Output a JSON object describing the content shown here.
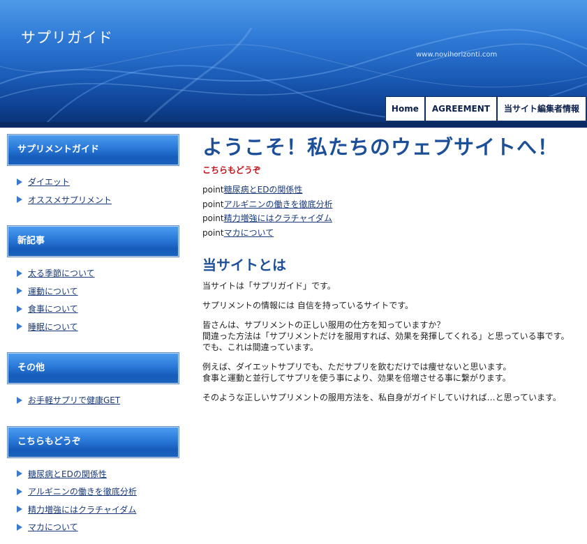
{
  "header": {
    "site_title": "サプリガイド",
    "site_url": "www.novihorizonti.com",
    "nav": [
      "Home",
      "AGREEMENT",
      "当サイト編集者情報"
    ]
  },
  "sidebar": {
    "blocks": [
      {
        "title": "サプリメントガイド",
        "items": [
          "ダイエット",
          "オススメサプリメント"
        ]
      },
      {
        "title": "新記事",
        "items": [
          "太る季節について",
          "運動について",
          "食事について",
          "睡眠について"
        ]
      },
      {
        "title": "その他",
        "items": [
          "お手軽サプリで健康GET"
        ]
      },
      {
        "title": "こちらもどうぞ",
        "items": [
          "糖尿病とEDの関係性",
          "アルギニンの働きを徹底分析",
          "精力増強にはクラチャイダム",
          "マカについて"
        ]
      }
    ]
  },
  "main": {
    "welcome": "ようこそ！私たちのウェブサイトへ！",
    "sub_red": "こちらもどうぞ",
    "point_prefix": "point",
    "points": [
      "糖尿病とEDの関係性",
      "アルギニンの働きを徹底分析",
      "精力増強にはクラチャイダム",
      "マカについて"
    ],
    "about_title": "当サイトとは",
    "paragraphs": [
      [
        "当サイトは「サプリガイド」です。"
      ],
      [
        "サプリメントの情報には 自信を持っているサイトです。"
      ],
      [
        "皆さんは、サプリメントの正しい服用の仕方を知っていますか？",
        "間違った方法は「サプリメントだけを服用すれば、効果を発揮してくれる」と思っている事です。",
        "でも、これは間違っています。"
      ],
      [
        "例えば、ダイエットサプリでも、ただサプリを飲むだけでは痩せないと思います。",
        "食事と運動と並行してサプリを使う事により、効果を倍増させる事に繋がります。"
      ],
      [
        "そのような正しいサプリメントの服用方法を、私自身がガイドしていければ…と思っています。"
      ]
    ]
  }
}
